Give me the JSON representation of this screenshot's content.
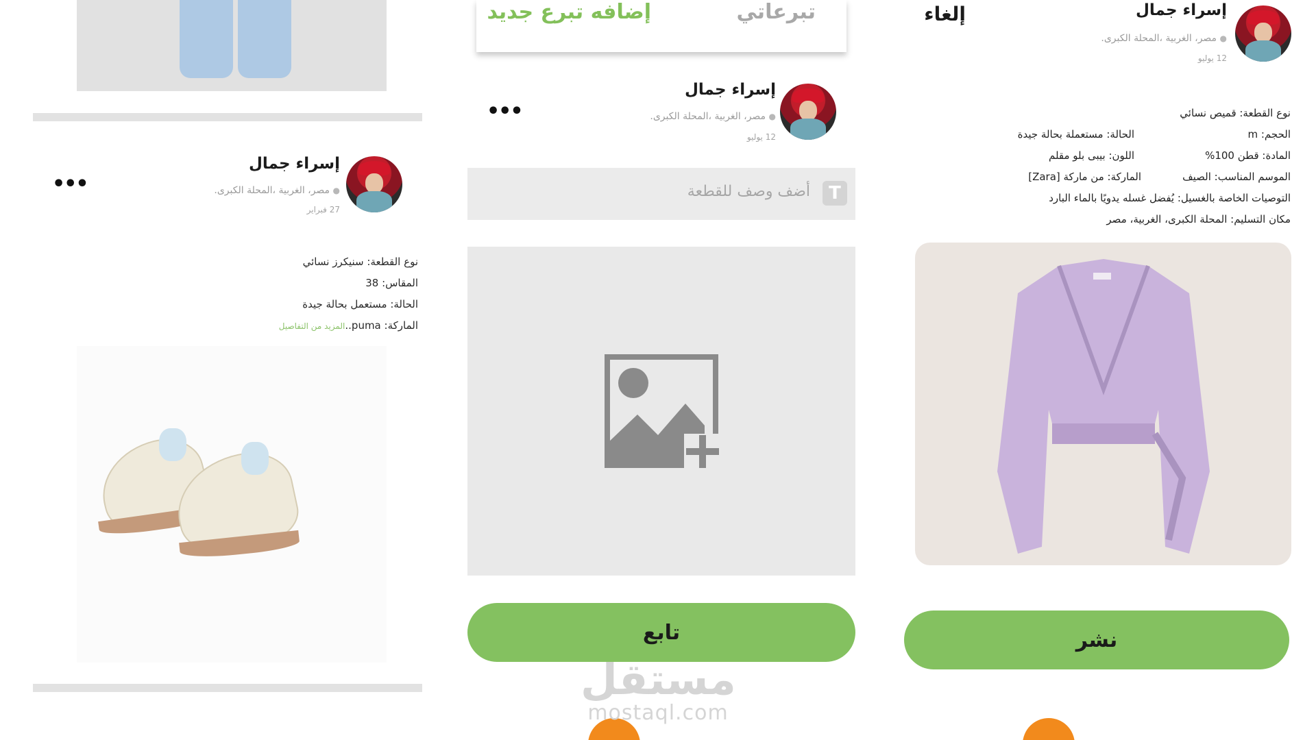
{
  "left_panel": {
    "post": {
      "user_name": "إسراء جمال",
      "location": "مصر، الغربية ،المحلة الكبرى.",
      "date": "27 فبراير",
      "more_menu": "•••",
      "details": [
        "نوع القطعة: سنيكرز نسائي",
        "المقاس: 38",
        "الحالة: مستعمل بحالة جيدة"
      ],
      "brand_line": "الماركة: puma..",
      "more_link": "المزيد من التفاصيل",
      "image_icon": "sneakers-photo"
    }
  },
  "middle_panel": {
    "tabs": {
      "new_donation": "إضافه تبرع جديد",
      "my_donations": "تبرعاتي"
    },
    "user_name": "إسراء جمال",
    "location": "مصر، الغربية ،المحلة الكبرى.",
    "date": "12 يوليو",
    "more_menu": "•••",
    "description_placeholder": "أضف وصف للقطعة",
    "description_icon": "T",
    "image_upload_icon": "add-image-icon",
    "follow_button": "تابع",
    "watermark": {
      "arabic": "مستقل",
      "english": "mostaql.com"
    }
  },
  "right_panel": {
    "cancel": "إلغاء",
    "user_name": "إسراء جمال",
    "location": "مصر، الغربية ،المحلة الكبرى.",
    "date": "12 يوليو",
    "specs": {
      "type": "نوع القطعة: قميص نسائي",
      "size": "الحجم: m",
      "condition": "الحالة: مستعملة بحالة جيدة",
      "material": "المادة: قطن 100%",
      "color": "اللون: بيبى بلو مقلم",
      "season": "الموسم المناسب: الصيف",
      "brand": "الماركة: من ماركة [Zara]",
      "washing": "التوصيات الخاصة بالغسيل: يُفضل غسله يدويًا بالماء البارد",
      "delivery": "مكان التسليم: المحلة الكبرى، الغربية، مصر"
    },
    "image_icon": "blouse-photo",
    "publish_button": "نشر"
  },
  "colors": {
    "accent_green": "#84c160",
    "orange": "#f28a1c",
    "placeholder_gray": "#e9e9e9"
  }
}
